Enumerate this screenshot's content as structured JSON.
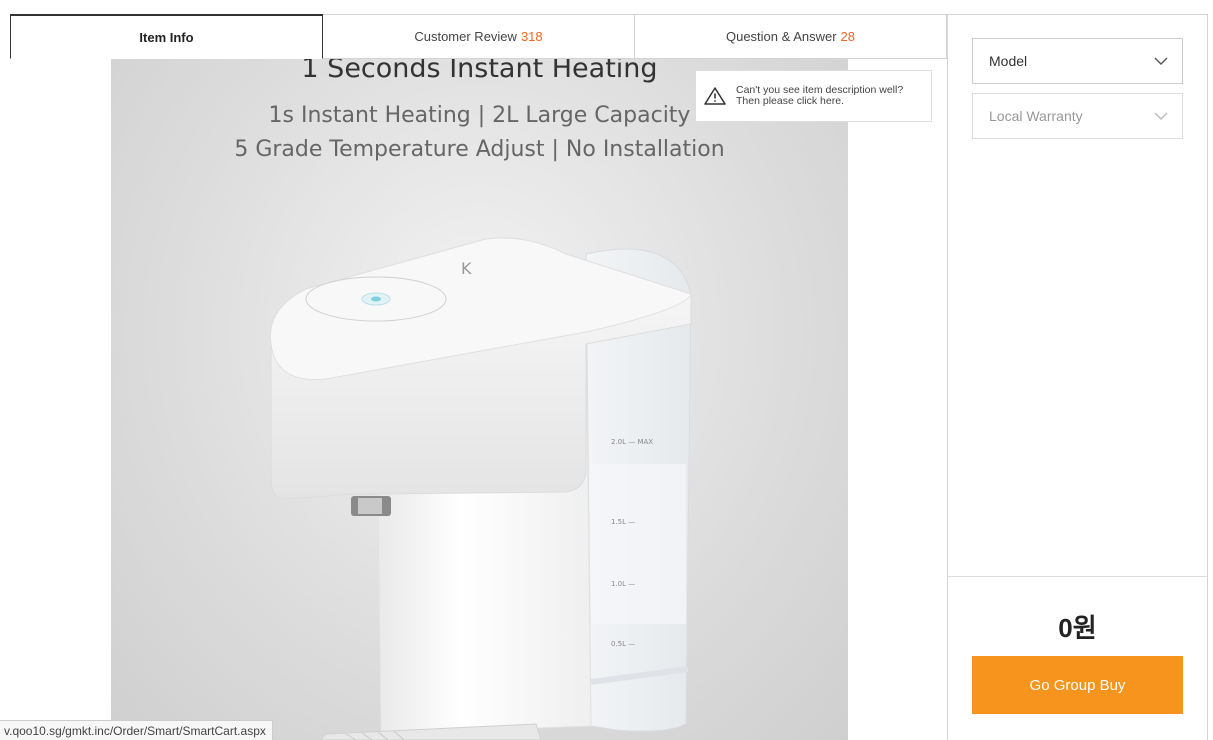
{
  "tabs": [
    {
      "label": "Item Info",
      "count": ""
    },
    {
      "label": "Customer Review",
      "count": "318"
    },
    {
      "label": "Question & Answer",
      "count": "28"
    }
  ],
  "product": {
    "headline": "1 Seconds Instant Heating",
    "subline1": "1s Instant Heating | 2L Large Capacity",
    "subline2": "5 Grade Temperature Adjust | No Installation",
    "tank_marks": [
      "2.0L — MAX",
      "1.5L —",
      "1.0L —",
      "0.5L —"
    ]
  },
  "notice": {
    "line1": "Can't you see item description well?",
    "line2": "Then please click here."
  },
  "sidebar": {
    "model_label": "Model",
    "warranty_label": "Local Warranty",
    "price": "0원",
    "buy_label": "Go Group Buy"
  },
  "statusbar": {
    "url": "v.qoo10.sg/gmkt.inc/Order/Smart/SmartCart.aspx"
  },
  "colors": {
    "accent": "#f7941d",
    "count": "#f26522"
  }
}
